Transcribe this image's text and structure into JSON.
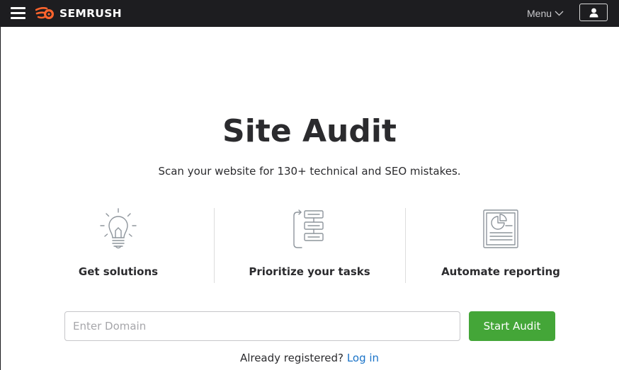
{
  "header": {
    "logo_text": "SEMRUSH",
    "menu_label": "Menu",
    "icons": {
      "hamburger": "hamburger-menu-icon",
      "logo": "semrush-flame-icon",
      "menu_chevron": "chevron-down-icon",
      "user": "user-icon"
    },
    "colors": {
      "bar_background": "#1d1d20",
      "logo_orange": "#ff642d"
    }
  },
  "hero": {
    "title": "Site Audit",
    "subtitle": "Scan your website for 130+ technical and SEO mistakes."
  },
  "features": [
    {
      "label": "Get solutions",
      "icon": "lightbulb-icon"
    },
    {
      "label": "Prioritize your tasks",
      "icon": "task-flow-icon"
    },
    {
      "label": "Automate reporting",
      "icon": "report-document-icon"
    }
  ],
  "form": {
    "domain_input": {
      "placeholder": "Enter Domain",
      "value": ""
    },
    "start_button_label": "Start Audit",
    "button_color": "#44a638"
  },
  "login": {
    "prompt": "Already registered?",
    "link_label": "Log in",
    "link_color": "#1a73c8"
  }
}
